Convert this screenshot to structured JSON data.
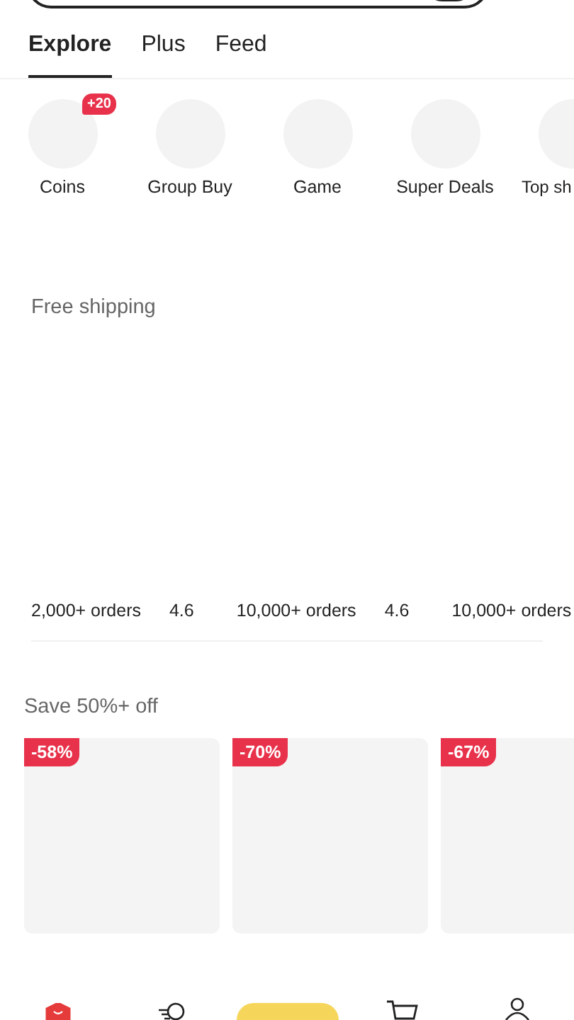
{
  "tabs": [
    {
      "label": "Explore",
      "selected": true
    },
    {
      "label": "Plus",
      "selected": false
    },
    {
      "label": "Feed",
      "selected": false
    }
  ],
  "categories": [
    {
      "label": "Coins",
      "badge": "+20"
    },
    {
      "label": "Group Buy"
    },
    {
      "label": "Game"
    },
    {
      "label": "Super Deals"
    },
    {
      "label": "Top sh"
    }
  ],
  "free_shipping": {
    "title": "Free shipping",
    "products": [
      {
        "orders": "2,000+ orders",
        "rating": "4.6"
      },
      {
        "orders": "10,000+ orders",
        "rating": "4.6"
      },
      {
        "orders": "10,000+ orders"
      }
    ]
  },
  "sale": {
    "title": "Save 50%+ off",
    "products": [
      {
        "discount": "-58%"
      },
      {
        "discount": "-70%"
      },
      {
        "discount": "-67%"
      }
    ]
  },
  "bottom_nav": [
    {
      "kind": "home",
      "selected": true
    },
    {
      "kind": "feed",
      "selected": false
    },
    {
      "kind": "pill",
      "selected": false
    },
    {
      "kind": "cart",
      "selected": false
    },
    {
      "kind": "account",
      "selected": false
    }
  ]
}
